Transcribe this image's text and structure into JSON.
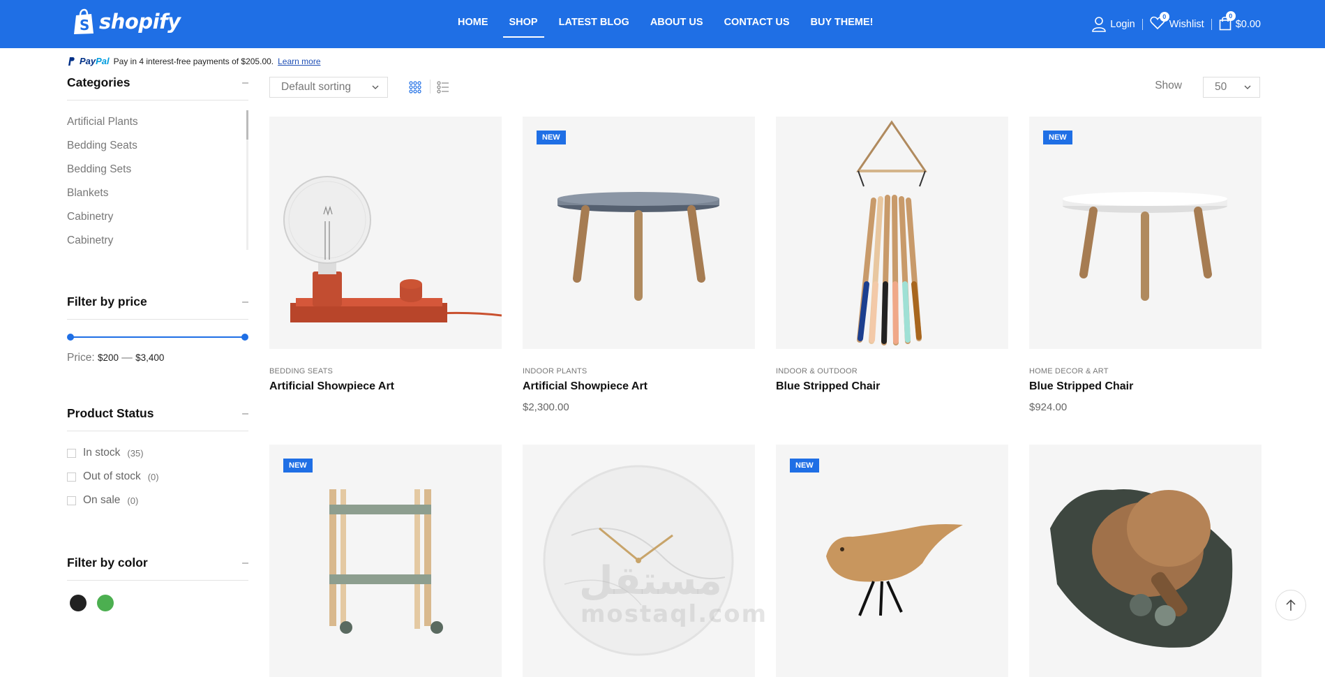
{
  "header": {
    "logo_text": "shopify",
    "nav": [
      {
        "label": "HOME",
        "active": false
      },
      {
        "label": "SHOP",
        "active": true
      },
      {
        "label": "LATEST BLOG",
        "active": false
      },
      {
        "label": "ABOUT US",
        "active": false
      },
      {
        "label": "CONTACT US",
        "active": false
      },
      {
        "label": "BUY THEME!",
        "active": false
      }
    ],
    "login_label": "Login",
    "wishlist_label": "Wishlist",
    "wishlist_count": "0",
    "cart_count": "0",
    "cart_total": "$0.00",
    "brand_color": "#1f6fe5"
  },
  "paypal": {
    "logo_a": "Pay",
    "logo_b": "Pal",
    "message": "Pay in 4 interest-free payments of $205.00.",
    "link": "Learn more"
  },
  "sidebar": {
    "categories_title": "Categories",
    "categories": [
      "Artificial Plants",
      "Bedding Seats",
      "Bedding Sets",
      "Blankets",
      "Cabinetry",
      "Cabinetry"
    ],
    "price_title": "Filter by price",
    "price_label": "Price:",
    "price_min": "$200",
    "price_dash": "—",
    "price_max": "$3,400",
    "status_title": "Product Status",
    "status": [
      {
        "label": "In stock",
        "count": "(35)"
      },
      {
        "label": "Out of stock",
        "count": "(0)"
      },
      {
        "label": "On sale",
        "count": "(0)"
      }
    ],
    "color_title": "Filter by color",
    "colors": [
      "#222222",
      "#4caf50"
    ],
    "collapse_symbol": "–"
  },
  "toolbar": {
    "sort_value": "Default sorting",
    "show_label": "Show",
    "show_value": "50"
  },
  "products": [
    {
      "category": "BEDDING SEATS",
      "title": "Artificial Showpiece Art",
      "price": "",
      "new": false,
      "image": "lamp"
    },
    {
      "category": "INDOOR PLANTS",
      "title": "Artificial Showpiece Art",
      "price": "$2,300.00",
      "new": true,
      "image": "grey-table"
    },
    {
      "category": "INDOOR & OUTDOOR",
      "title": "Blue Stripped Chair",
      "price": "",
      "new": false,
      "image": "pencils"
    },
    {
      "category": "HOME DECOR & ART",
      "title": "Blue Stripped Chair",
      "price": "$924.00",
      "new": true,
      "image": "white-table"
    },
    {
      "category": "",
      "title": "",
      "price": "",
      "new": true,
      "image": "trolley"
    },
    {
      "category": "",
      "title": "",
      "price": "",
      "new": false,
      "image": "clock"
    },
    {
      "category": "",
      "title": "",
      "price": "",
      "new": true,
      "image": "bird"
    },
    {
      "category": "",
      "title": "",
      "price": "",
      "new": false,
      "image": "pingpong"
    }
  ],
  "new_badge": "NEW",
  "watermark": {
    "line1": "مستقل",
    "line2": "mostaql.com"
  }
}
